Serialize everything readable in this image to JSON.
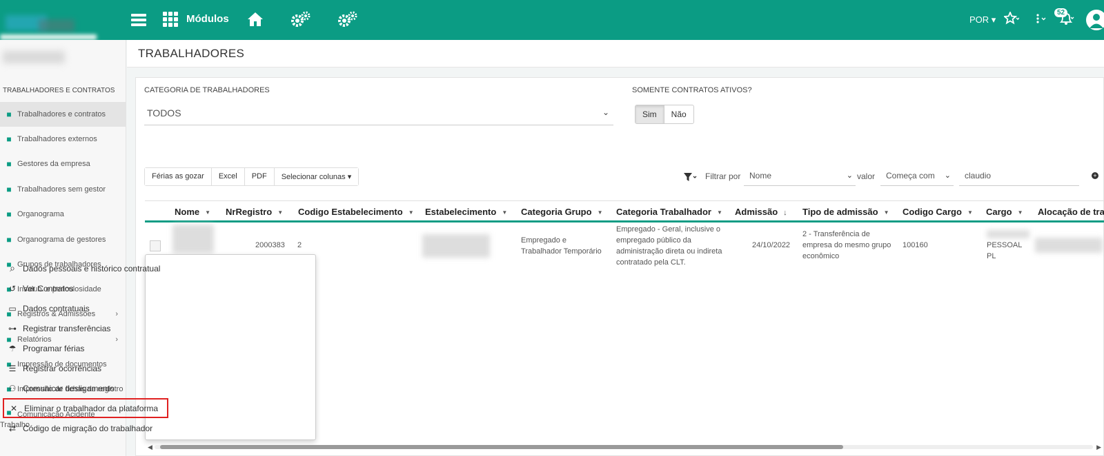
{
  "topbar": {
    "modulos_label": "Módulos",
    "language": "POR",
    "notification_count": "52",
    "accent_color": "#0b9c84"
  },
  "sidebar": {
    "section_title": "TRABALHADORES E CONTRATOS",
    "items": [
      {
        "label": "Trabalhadores e contratos",
        "icon": "id-badge-icon"
      },
      {
        "label": "Trabalhadores externos",
        "icon": "id-badge-icon"
      },
      {
        "label": "Gestores da empresa",
        "icon": "users-icon"
      },
      {
        "label": "Trabalhadores sem gestor",
        "icon": "sitemap-icon"
      },
      {
        "label": "Organograma",
        "icon": "sitemap-icon"
      },
      {
        "label": "Organograma de gestores",
        "icon": "users-icon"
      },
      {
        "label": "Grupos de trabalhadores",
        "icon": "users-icon"
      },
      {
        "label": "Insalub. e periculosidade",
        "icon": "user-shield-icon"
      },
      {
        "label": "Registros & Admissões",
        "icon": "file-icon"
      },
      {
        "label": "Relatórios",
        "icon": "file-icon"
      },
      {
        "label": "Impressão de documentos",
        "icon": "file-icon"
      },
      {
        "label": "Impressão de fichas de registro",
        "icon": "file-icon"
      },
      {
        "label_line1": "Comunicação Acidente",
        "label_line2": "Trabalho",
        "icon": "file-medical-icon"
      }
    ]
  },
  "page": {
    "title": "TRABALHADORES"
  },
  "filters": {
    "category_label": "CATEGORIA DE TRABALHADORES",
    "category_value": "TODOS",
    "active_label": "SOMENTE CONTRATOS ATIVOS?",
    "active_yes": "Sim",
    "active_no": "Não",
    "filtrar_por": "Filtrar por",
    "filter_field": "Nome",
    "valor_label": "valor",
    "operator": "Começa com",
    "search_value": "claudio"
  },
  "toolbar": {
    "ferias": "Férias as gozar",
    "excel": "Excel",
    "pdf": "PDF",
    "select_cols": "Selecionar colunas"
  },
  "table": {
    "headers": {
      "nome": "Nome",
      "nr": "NrRegistro",
      "cod_est": "Codigo Estabelecimento",
      "est": "Estabelecimento",
      "cat_grupo": "Categoria Grupo",
      "cat_trab": "Categoria Trabalhador",
      "admissao": "Admissão",
      "tipo_adm": "Tipo de admissão",
      "cod_cargo": "Codigo Cargo",
      "cargo": "Cargo",
      "alocacao": "Alocação de tra"
    },
    "row": {
      "nr": "2000383",
      "cod_est": "2",
      "cat_grupo_1": "Empregado e",
      "cat_grupo_2": "Trabalhador Temporário",
      "cat_trab_1": "Empregado - Geral, inclusive o",
      "cat_trab_2": "empregado público da",
      "cat_trab_3": "administração direta ou indireta",
      "cat_trab_4": "contratado pela CLT.",
      "admissao": "24/10/2022",
      "tipo_1": "2 - Transferência de",
      "tipo_2": "empresa do mesmo grupo",
      "tipo_3": "econômico",
      "cod_cargo": "100160",
      "cargo_1": "PESSOAL",
      "cargo_2": "PL"
    }
  },
  "context_menu": {
    "items": [
      {
        "label": "Dados pessoais e histórico contratual",
        "icon": "search-icon"
      },
      {
        "label": "Ver Contratos",
        "icon": "history-icon"
      },
      {
        "label": "Dados contratuais",
        "icon": "id-card-icon"
      },
      {
        "label": "Registrar transferências",
        "icon": "network-icon"
      },
      {
        "label": "Programar férias",
        "icon": "umbrella-beach-icon"
      },
      {
        "label": "Registrar ocorrências",
        "icon": "list-icon"
      },
      {
        "label": "Comunicar desligamento",
        "icon": "user-times-icon"
      },
      {
        "label": "Eliminar o trabalhador da plataforma",
        "icon": "close-icon"
      },
      {
        "label": "Código de migração do trabalhador",
        "icon": "exchange-icon"
      }
    ]
  }
}
